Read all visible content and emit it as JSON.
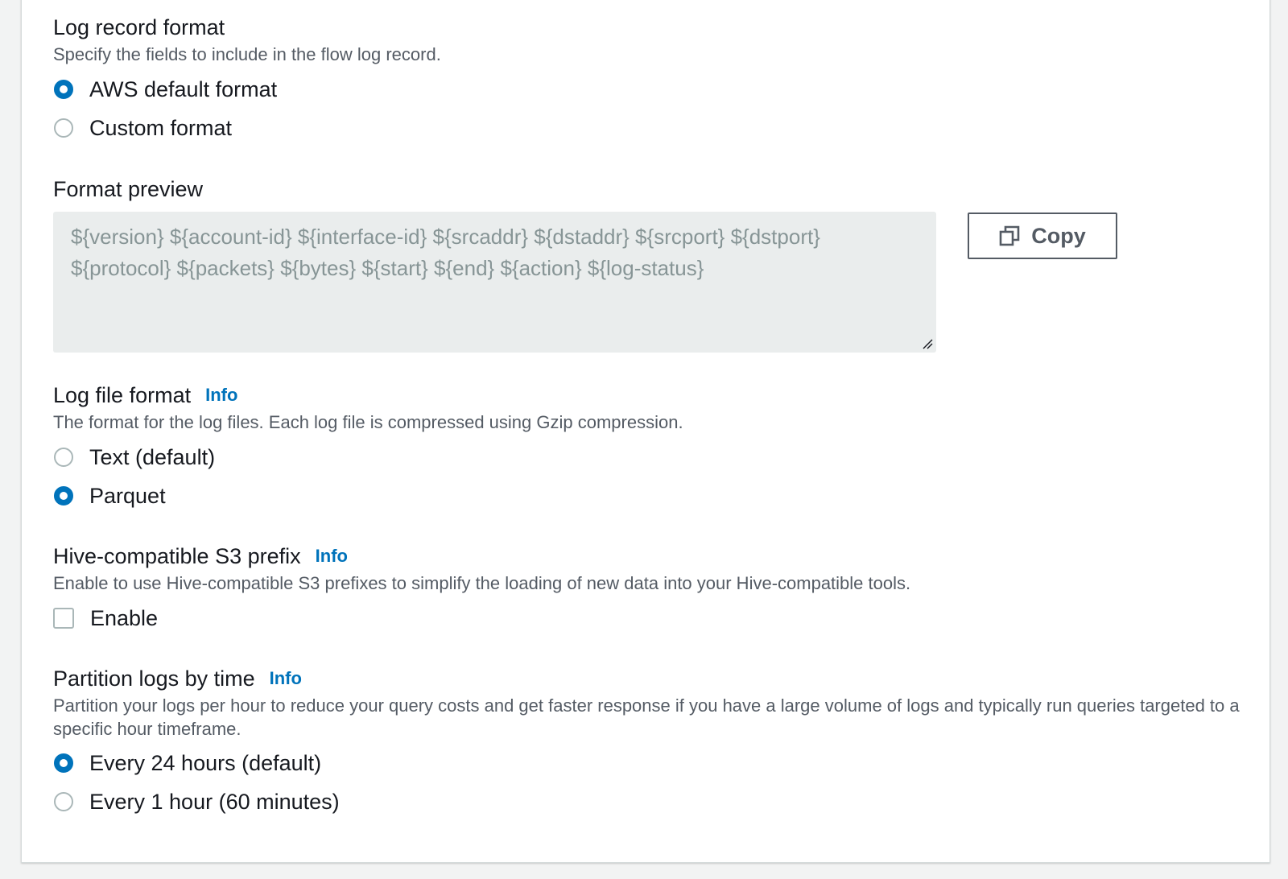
{
  "log_record_format": {
    "title": "Log record format",
    "description": "Specify the fields to include in the flow log record.",
    "options": [
      {
        "label": "AWS default format",
        "selected": true
      },
      {
        "label": "Custom format",
        "selected": false
      }
    ]
  },
  "format_preview": {
    "title": "Format preview",
    "text": "${version} ${account-id} ${interface-id} ${srcaddr} ${dstaddr} ${srcport} ${dstport} ${protocol} ${packets} ${bytes} ${start} ${end} ${action} ${log-status}",
    "copy_label": "Copy"
  },
  "log_file_format": {
    "title": "Log file format",
    "info": "Info",
    "description": "The format for the log files. Each log file is compressed using Gzip compression.",
    "options": [
      {
        "label": "Text (default)",
        "selected": false
      },
      {
        "label": "Parquet",
        "selected": true
      }
    ]
  },
  "hive_prefix": {
    "title": "Hive-compatible S3 prefix",
    "info": "Info",
    "description": "Enable to use Hive-compatible S3 prefixes to simplify the loading of new data into your Hive-compatible tools.",
    "checkbox_label": "Enable",
    "checked": false
  },
  "partition": {
    "title": "Partition logs by time",
    "info": "Info",
    "description": "Partition your logs per hour to reduce your query costs and get faster response if you have a large volume of logs and typically run queries targeted to a specific hour timeframe.",
    "options": [
      {
        "label": "Every 24 hours (default)",
        "selected": true
      },
      {
        "label": "Every 1 hour (60 minutes)",
        "selected": false
      }
    ]
  },
  "colors": {
    "accent": "#0073bb",
    "text": "#16191f",
    "secondary_text": "#545b64"
  },
  "icons": {
    "copy": "copy-icon",
    "resize": "resize-handle-icon"
  }
}
